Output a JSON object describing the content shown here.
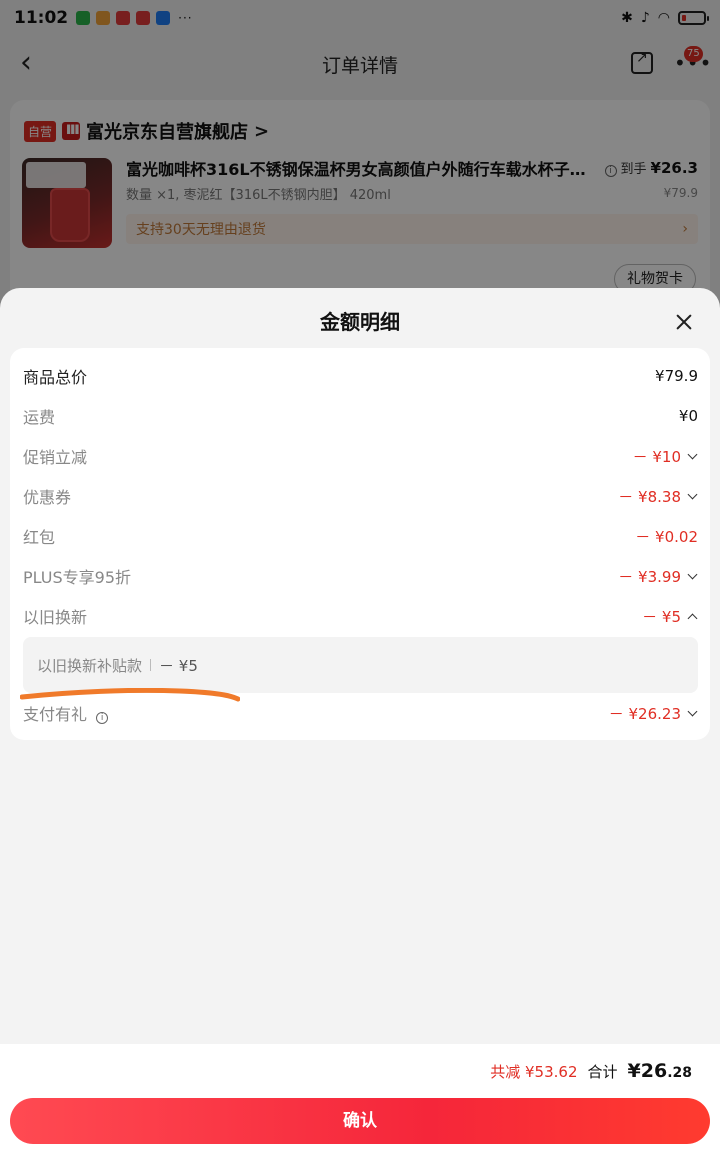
{
  "statusbar": {
    "time": "11:02",
    "more": "···",
    "apps": [
      "wechat-icon",
      "weibo-icon",
      "app-red-icon",
      "app-red-icon-2",
      "alipay-icon"
    ]
  },
  "header": {
    "title": "订单详情",
    "badge": "75"
  },
  "order": {
    "self_tag": "自营",
    "store_name": "富光京东自营旗舰店",
    "store_chevron": ">",
    "product_title": "富光咖啡杯316L不锈钢保温杯男女高颜值户外随行车载水杯子家…",
    "product_spec": "数量 ×1, 枣泥红【316L不锈钢内胆】 420ml",
    "final_label": "到手",
    "final_price": "¥26.3",
    "original_price": "¥79.9",
    "return_policy": "支持30天无理由退货",
    "return_chevron": "›",
    "gift_card": "礼物贺卡"
  },
  "sheet": {
    "title": "金额明细",
    "rows": [
      {
        "label": "商品总价",
        "value": "¥79.9"
      },
      {
        "label": "运费",
        "value": "¥0"
      },
      {
        "label": "促销立减",
        "value": "－ ¥10"
      },
      {
        "label": "优惠券",
        "value": "－ ¥8.38"
      },
      {
        "label": "红包",
        "value": "－ ¥0.02"
      },
      {
        "label": "PLUS专享95折",
        "value": "－ ¥3.99"
      },
      {
        "label": "以旧换新",
        "value": "－ ¥5"
      },
      {
        "label": "支付有礼",
        "value": "－ ¥26.23"
      }
    ],
    "trade_in_sub": {
      "label": "以旧换新补贴款",
      "value": "－ ¥5"
    }
  },
  "footer": {
    "saved_label": "共减",
    "saved_value": "¥53.62",
    "total_label": "合计",
    "total_int": "¥26",
    "total_dec": ".28",
    "confirm": "确认"
  },
  "colors": {
    "accent": "#e02e24",
    "button_gradient_start": "#ff4a52",
    "button_gradient_end": "#ff3b2f",
    "annotation_stroke": "#f07a2a"
  }
}
